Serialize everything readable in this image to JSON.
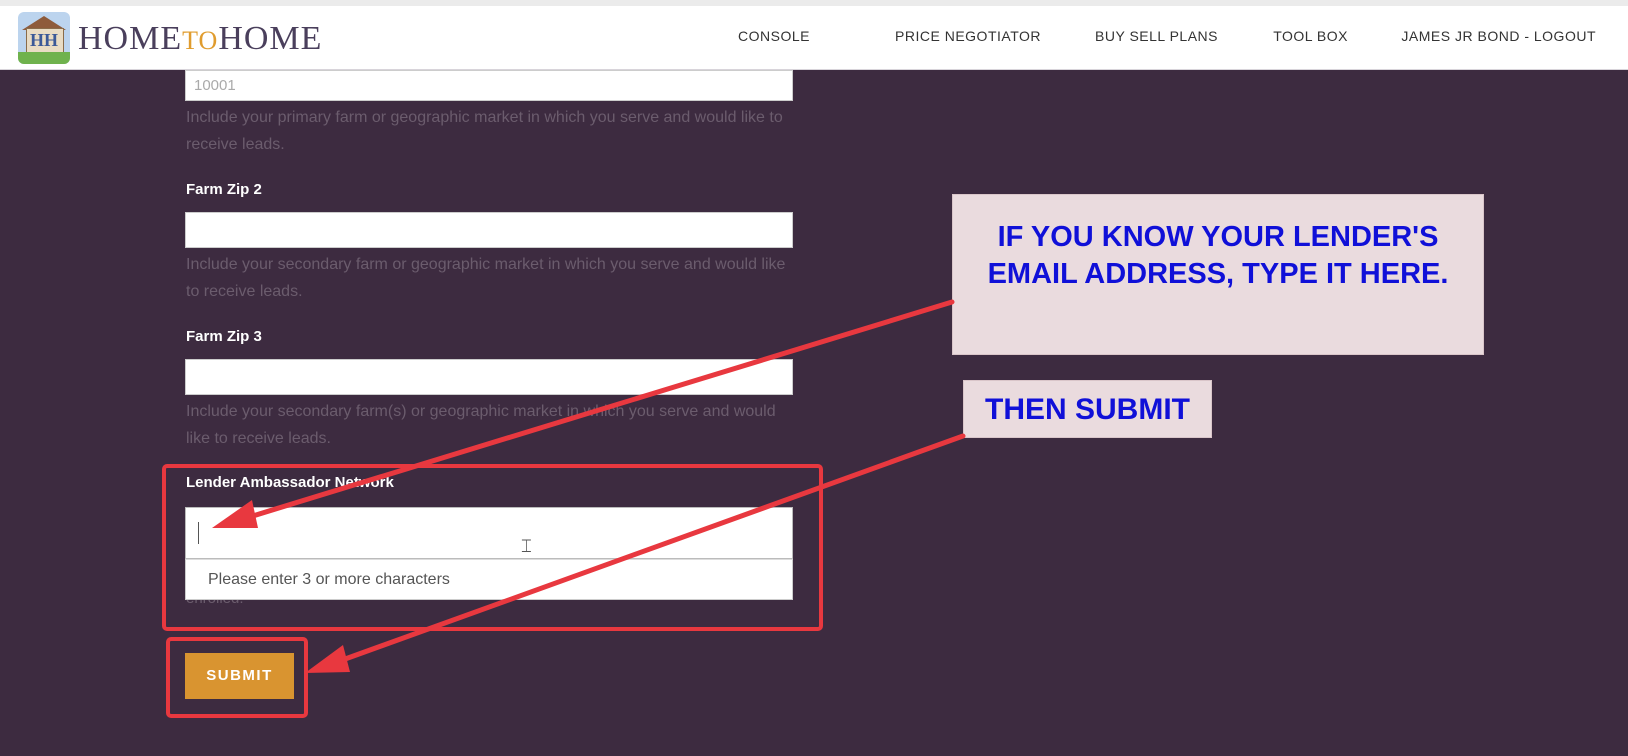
{
  "brand": {
    "logo_letters": "HH",
    "name_part1": "HOME",
    "name_part2": "TO",
    "name_part3": "HOME"
  },
  "nav": {
    "items": [
      "CONSOLE",
      "PRICE NEGOTIATOR",
      "BUY SELL PLANS",
      "TOOL BOX",
      "JAMES JR BOND - LOGOUT"
    ]
  },
  "form": {
    "farm_zip_1": {
      "value": "10001",
      "hint": "Include your primary farm or geographic market in which you serve and would like to receive leads."
    },
    "farm_zip_2": {
      "label": "Farm Zip 2",
      "value": "",
      "hint": "Include your secondary farm or geographic market in which you serve and would like to receive leads."
    },
    "farm_zip_3": {
      "label": "Farm Zip 3",
      "value": "",
      "hint": "Include your secondary farm(s) or geographic market in which you serve and would like to receive leads."
    },
    "lender": {
      "label": "Lender Ambassador Network",
      "dropdown_message": "Please enter 3 or more characters",
      "under_text": "enrolled."
    },
    "submit_label": "SUBMIT"
  },
  "annotations": {
    "callout_1": "IF YOU KNOW YOUR LENDER'S EMAIL ADDRESS, TYPE IT HERE.",
    "callout_2": "THEN SUBMIT"
  },
  "colors": {
    "background": "#3d2b40",
    "accent": "#d99430",
    "highlight": "#e8383f",
    "callout_text": "#1010d8",
    "callout_bg": "#eadbde"
  }
}
